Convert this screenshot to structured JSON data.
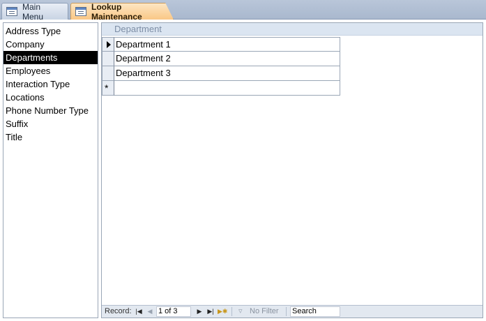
{
  "tabs": [
    {
      "label": "Main Menu",
      "active": false
    },
    {
      "label": "Lookup Maintenance",
      "active": true
    }
  ],
  "lookup_list": {
    "items": [
      {
        "label": "Address Type"
      },
      {
        "label": "Company"
      },
      {
        "label": "Departments",
        "selected": true
      },
      {
        "label": "Employees"
      },
      {
        "label": "Interaction Type"
      },
      {
        "label": "Locations"
      },
      {
        "label": "Phone Number Type"
      },
      {
        "label": "Suffix"
      },
      {
        "label": "Title"
      }
    ]
  },
  "datasheet": {
    "column_header": "Department",
    "rows": [
      {
        "department": "Department 1",
        "current": true
      },
      {
        "department": "Department 2"
      },
      {
        "department": "Department 3"
      }
    ],
    "new_record_symbol": "*"
  },
  "record_nav": {
    "label": "Record:",
    "position": "1 of 3",
    "filter_label": "No Filter",
    "search_label": "Search",
    "first_icon": "first-record-icon",
    "prev_icon": "prev-record-icon",
    "next_icon": "next-record-icon",
    "last_icon": "last-record-icon",
    "new_icon": "new-record-icon"
  }
}
